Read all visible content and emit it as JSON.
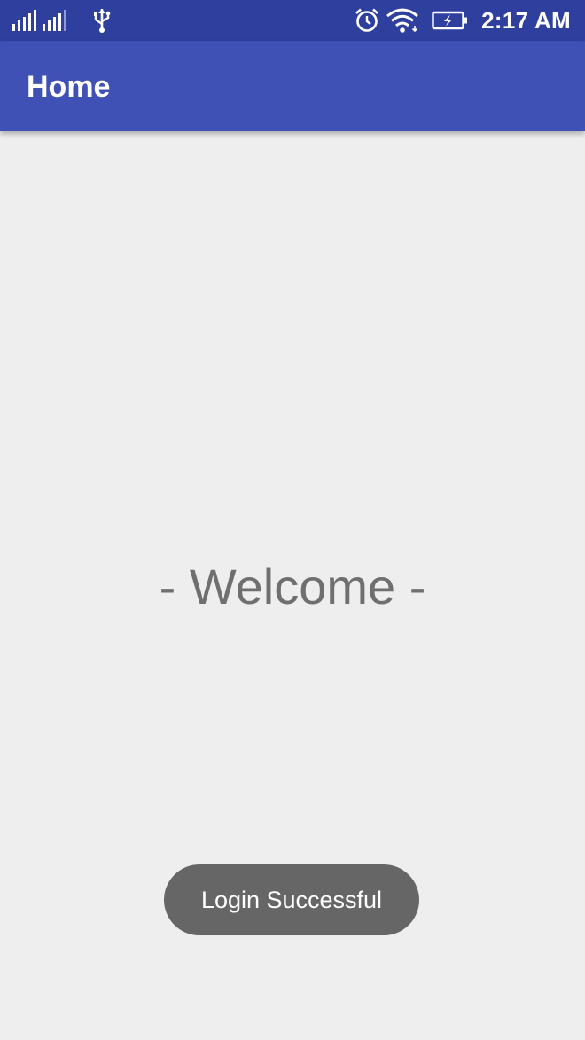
{
  "status_bar": {
    "time": "2:17 AM",
    "icons": [
      "signal-icon",
      "signal-icon-2",
      "usb-icon",
      "alarm-icon",
      "wifi-icon",
      "battery-charging-icon"
    ]
  },
  "app_bar": {
    "title": "Home"
  },
  "main": {
    "welcome_text": "- Welcome -"
  },
  "toast": {
    "message": "Login Successful"
  },
  "colors": {
    "status_bar": "#2f3f9e",
    "app_bar": "#3f51b5",
    "background": "#eeeeee",
    "welcome_text": "#6f6f6f",
    "toast_bg": "#666666"
  }
}
